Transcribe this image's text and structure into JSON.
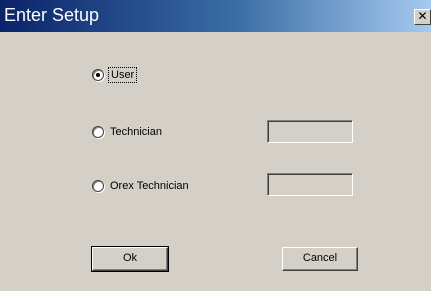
{
  "window": {
    "title": "Enter Setup",
    "close_glyph": "✕"
  },
  "options": [
    {
      "label": "User",
      "checked": true
    },
    {
      "label": "Technician",
      "checked": false
    },
    {
      "label": "Orex Technician",
      "checked": false
    }
  ],
  "fields": {
    "technician_value": "",
    "orex_technician_value": ""
  },
  "buttons": {
    "ok_label": "Ok",
    "cancel_label": "Cancel"
  },
  "colors": {
    "face": "#d4d0c8",
    "title_start": "#0a246a",
    "title_end": "#a6caf0"
  }
}
